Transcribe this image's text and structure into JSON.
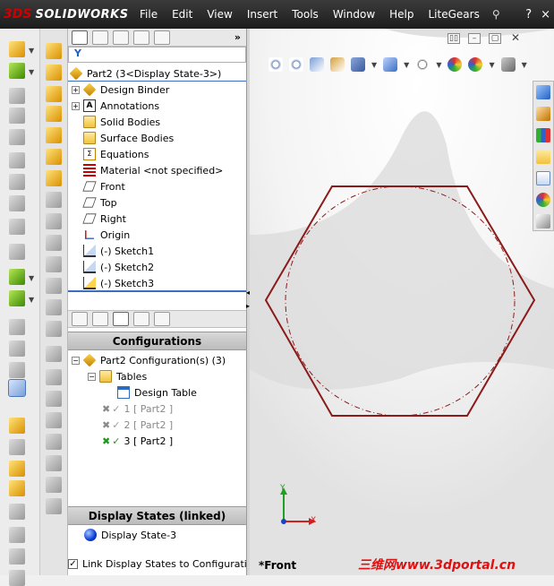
{
  "app": {
    "logo_prefix": "3DS",
    "logo_name": "SOLIDWORKS"
  },
  "menu": [
    "File",
    "Edit",
    "View",
    "Insert",
    "Tools",
    "Window",
    "Help",
    "LiteGears"
  ],
  "window_controls": {
    "pin": "⚲",
    "help": "?",
    "close": "×"
  },
  "feature_tree": {
    "root_label": "Part2  (3<Display State-3>)",
    "items": [
      {
        "label": "Design Binder",
        "icon": "design-binder-icon"
      },
      {
        "label": "Annotations",
        "icon": "annotations-icon"
      },
      {
        "label": "Solid Bodies",
        "icon": "solid-bodies-folder-icon"
      },
      {
        "label": "Surface Bodies",
        "icon": "surface-bodies-folder-icon"
      },
      {
        "label": "Equations",
        "icon": "equations-icon"
      },
      {
        "label": "Material <not specified>",
        "icon": "material-icon"
      },
      {
        "label": "Front",
        "icon": "plane-icon"
      },
      {
        "label": "Top",
        "icon": "plane-icon"
      },
      {
        "label": "Right",
        "icon": "plane-icon"
      },
      {
        "label": "Origin",
        "icon": "origin-icon"
      },
      {
        "label": "(-) Sketch1",
        "icon": "sketch-icon"
      },
      {
        "label": "(-) Sketch2",
        "icon": "sketch-icon"
      },
      {
        "label": "(-) Sketch3",
        "icon": "sketch-icon"
      }
    ]
  },
  "config_manager": {
    "header": "Configurations",
    "root_label": "Part2 Configuration(s)  (3)",
    "tables_label": "Tables",
    "design_table_label": "Design Table",
    "configs": [
      {
        "num": "1",
        "name": "[ Part2 ]",
        "active": false
      },
      {
        "num": "2",
        "name": "[ Part2 ]",
        "active": false
      },
      {
        "num": "3",
        "name": "[ Part2 ]",
        "active": true
      }
    ]
  },
  "display_states": {
    "header": "Display States (linked)",
    "item": "Display State-3",
    "link_checkbox_label": "Link Display States to Configurations",
    "link_checked": true
  },
  "graphics": {
    "view_name": "*Front",
    "triad_y": "Y",
    "triad_x": "X",
    "watermark": "三维网www.3dportal.cn"
  },
  "colors": {
    "sketch_line": "#8b1a1a",
    "triad_x": "#d02020",
    "triad_y": "#20a020",
    "accent": "#3a6fc0"
  }
}
